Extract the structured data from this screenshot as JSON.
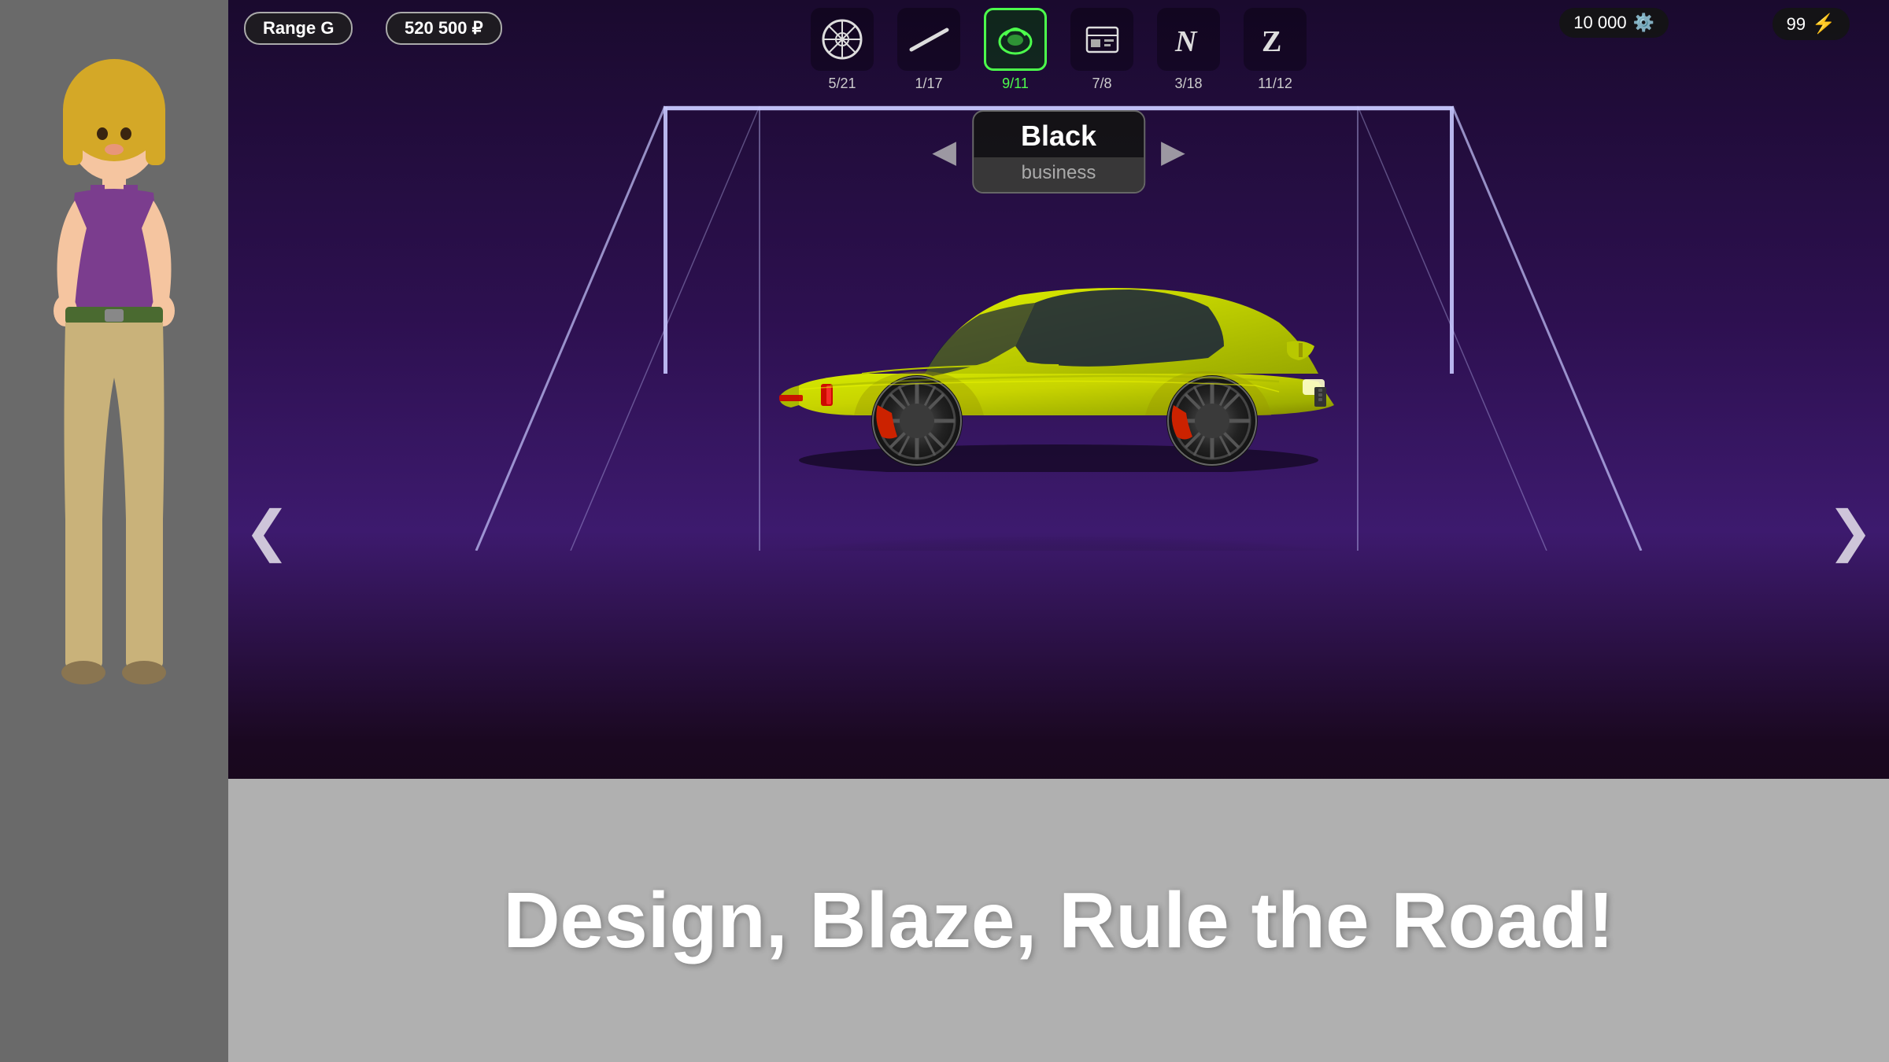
{
  "header": {
    "range_label": "Range G",
    "price": "520 500",
    "currency_symbol": "₽",
    "coins": "10 000",
    "lightning_count": "99"
  },
  "categories": [
    {
      "id": "wheels",
      "label": "5/21",
      "active": false
    },
    {
      "id": "stripe",
      "label": "1/17",
      "active": false
    },
    {
      "id": "color",
      "label": "9/11",
      "active": true
    },
    {
      "id": "livery",
      "label": "7/8",
      "active": false
    },
    {
      "id": "style1",
      "label": "3/18",
      "active": false
    },
    {
      "id": "style2",
      "label": "11/12",
      "active": false
    }
  ],
  "color_selector": {
    "current_color": "Black",
    "color_type": "business",
    "prev_arrow": "◀",
    "next_arrow": "▶"
  },
  "navigation": {
    "left_arrow": "❮",
    "right_arrow": "❯"
  },
  "tagline": "Design, Blaze, Rule the Road!"
}
